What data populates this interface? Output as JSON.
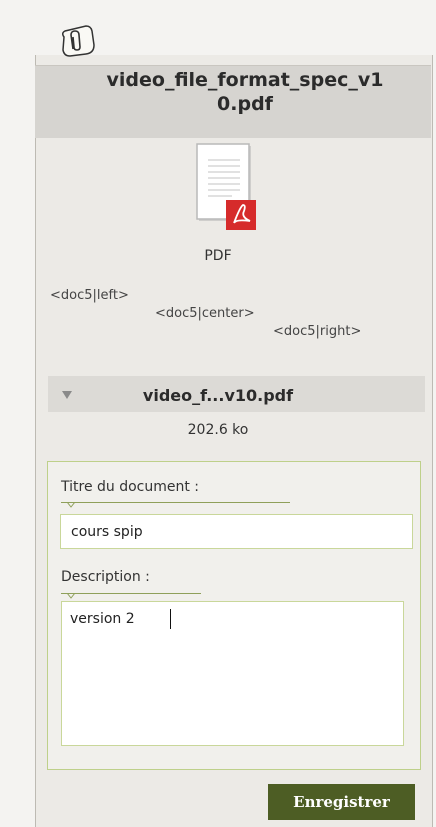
{
  "document": {
    "filename": "video_file_format_spec_v10.pdf",
    "type_label": "PDF",
    "short_name": "video_f...v10.pdf",
    "size": "202.6 ko"
  },
  "embed_codes": {
    "left": "<doc5|left>",
    "center": "<doc5|center>",
    "right": "<doc5|right>"
  },
  "form": {
    "title_label": "Titre du document :",
    "title_value": "cours spip",
    "description_label": "Description :",
    "description_value": "version 2",
    "save_label": "Enregistrer"
  },
  "icons": {
    "attachment": "paperclip-icon",
    "file": "pdf-file-icon",
    "toggle": "triangle-down-icon"
  },
  "colors": {
    "accent": "#4d5d24",
    "field_border": "#c9d79a",
    "pdf_red": "#d62b2b"
  }
}
